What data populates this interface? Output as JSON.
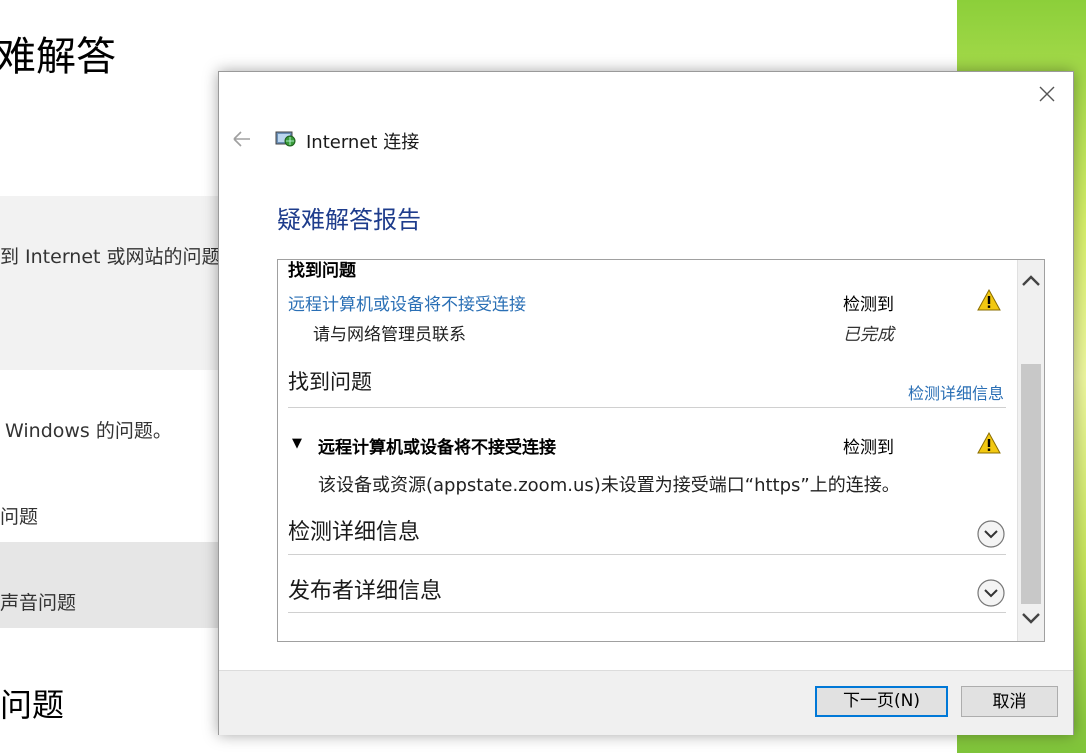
{
  "background": {
    "title": "难解答",
    "item1": "到 Internet 或网站的问题",
    "item2": "Windows 的问题。",
    "item3": "问题",
    "item4": "声音问题",
    "heading2": "问题"
  },
  "dialog": {
    "app_title": "Internet 连接",
    "report_title": "疑难解答报告",
    "report": {
      "found_top": "找到问题",
      "problem1_link": "远程计算机或设备将不接受连接",
      "problem1_status": "检测到",
      "sub_action": "请与网络管理员联系",
      "sub_status": "已完成",
      "found_heading": "找到问题",
      "details_link": "检测详细信息",
      "problem2_title": "远程计算机或设备将不接受连接",
      "problem2_status": "检测到",
      "problem2_desc": "该设备或资源(appstate.zoom.us)未设置为接受端口“https”上的连接。",
      "section_detect": "检测详细信息",
      "section_publisher": "发布者详细信息"
    },
    "buttons": {
      "next": "下一页(N)",
      "cancel": "取消"
    }
  },
  "icons": {
    "close": "close-icon",
    "back": "back-arrow-icon",
    "app": "network-icon",
    "warning": "warning-icon",
    "expand": "expand-triangle-icon",
    "chevron": "chevron-down-circle-icon"
  },
  "colors": {
    "link": "#2a6fb5",
    "title": "#1e3c8c",
    "accent": "#0078d7",
    "warning": "#f2c811"
  }
}
